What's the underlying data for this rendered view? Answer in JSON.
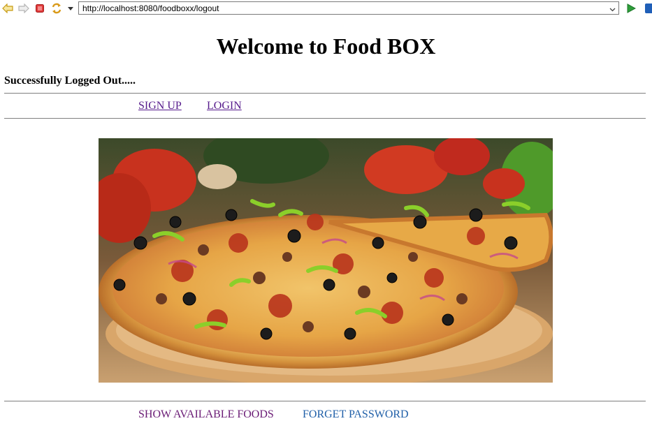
{
  "browser": {
    "url": "http://localhost:8080/foodboxx/logout"
  },
  "page": {
    "title": "Welcome to Food BOX",
    "status_message": "Successfully Logged Out.....",
    "nav": {
      "signup_label": "SIGN UP",
      "login_label": "LOGIN"
    },
    "bottom_links": {
      "show_foods_label": "SHOW AVAILABLE FOODS",
      "forget_password_label": "FORGET PASSWORD"
    }
  },
  "icons": {
    "back": "back-arrow-icon",
    "forward": "forward-arrow-icon",
    "stop": "stop-icon",
    "refresh": "refresh-icon",
    "menu": "dropdown-arrow-icon",
    "go": "go-play-icon"
  },
  "colors": {
    "visited_link": "#551a8b",
    "show_foods_link": "#6a1b75",
    "forget_password_link": "#1f5fa8",
    "stop_red": "#e03a3a",
    "go_green": "#2e9d3a"
  }
}
